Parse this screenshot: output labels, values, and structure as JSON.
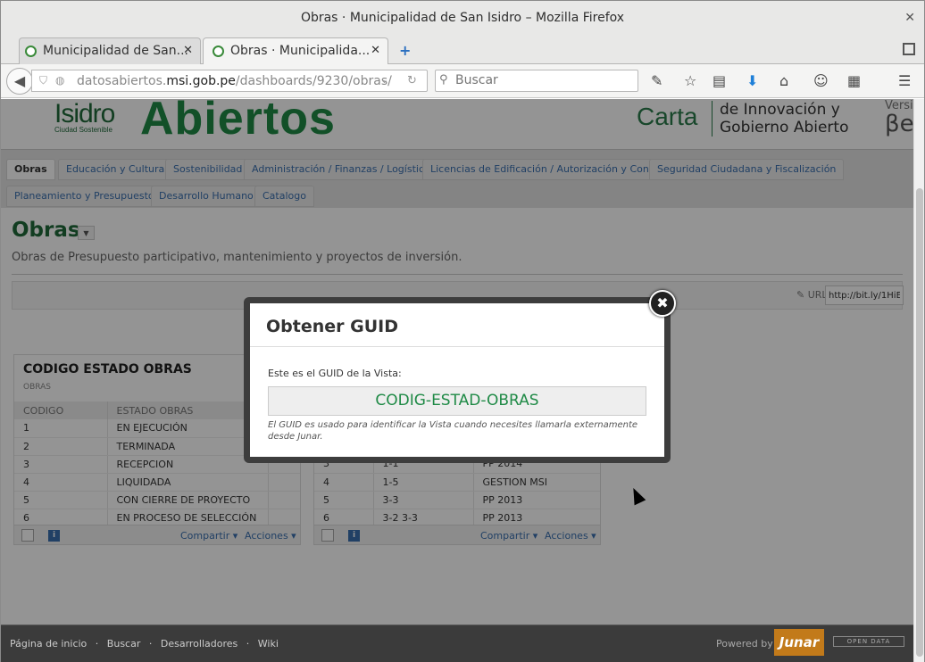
{
  "window": {
    "title": "Obras · Municipalidad de San Isidro – Mozilla Firefox",
    "close_glyph": "✕"
  },
  "tabs": [
    {
      "label": "Municipalidad de San...",
      "close": "✕"
    },
    {
      "label": "Obras · Municipalida...",
      "close": "✕"
    }
  ],
  "newtab_glyph": "+",
  "nav": {
    "back_glyph": "◀",
    "url_prefix": "datosabiertos.",
    "url_domain": "msi.gob.pe",
    "url_path": "/dashboards/9230/obras/",
    "search_placeholder": "Buscar"
  },
  "banner": {
    "isidro": "Isidro",
    "isidro_sub": "Ciudad Sostenible",
    "abiertos": "Abiertos",
    "carta": "Carta",
    "carta_sub_1": "de Innovación y",
    "carta_sub_2": "Gobierno Abierto",
    "version": "Versi",
    "beta": "βet"
  },
  "navtabs": [
    "Obras",
    "Educación y Cultura",
    "Sostenibilidad",
    "Administración / Finanzas / Logística",
    "Licencias de Edificación / Autorización y Control",
    "Seguridad Ciudadana y Fiscalización",
    "Planeamiento y Presupuesto",
    "Desarrollo Humano",
    "Catalogo"
  ],
  "page": {
    "title": "Obras",
    "description": "Obras de Presupuesto participativo, mantenimiento y proyectos de inversión.",
    "url_label": "URL:",
    "url_value": "http://bit.ly/1HiEA"
  },
  "card1": {
    "title": "CODIGO ESTADO OBRAS",
    "subtitle": "OBRAS",
    "headers": [
      "CODIGO",
      "ESTADO OBRAS",
      ""
    ],
    "rows": [
      [
        "1",
        "EN EJECUCIÓN",
        ""
      ],
      [
        "2",
        "TERMINADA",
        ""
      ],
      [
        "3",
        "RECEPCION",
        ""
      ],
      [
        "4",
        "LIQUIDADA",
        ""
      ],
      [
        "5",
        "CON CIERRE DE PROYECTO",
        ""
      ],
      [
        "6",
        "EN PROCESO DE SELECCIÓN",
        ""
      ]
    ],
    "share": "Compartir",
    "actions": "Acciones"
  },
  "card2": {
    "rows": [
      [
        "3",
        "1-1",
        "PP 2014"
      ],
      [
        "4",
        "1-5",
        "GESTION MSI"
      ],
      [
        "5",
        "3-3",
        "PP 2013"
      ],
      [
        "6",
        "3-2 3-3",
        "PP 2013"
      ]
    ],
    "share": "Compartir",
    "actions": "Acciones"
  },
  "footer": {
    "links": [
      "Página de inicio",
      "·",
      "Buscar",
      "·",
      "Desarrolladores",
      "·",
      "Wiki"
    ],
    "powered": "Powered by",
    "junar": "Junar",
    "opendata": "OPEN DATA"
  },
  "modal": {
    "title": "Obtener GUID",
    "text": "Este es el GUID de la Vista:",
    "guid": "CODIG-ESTAD-OBRAS",
    "note": "El GUID es usado para identificar la Vista cuando necesites llamarla externamente desde Junar.",
    "close_glyph": "✖"
  }
}
